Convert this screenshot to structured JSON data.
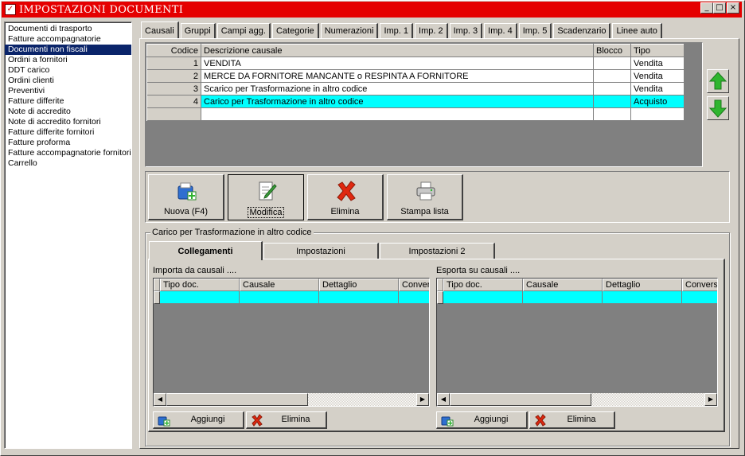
{
  "window": {
    "title": "IMPOSTAZIONI DOCUMENTI",
    "controls": [
      "_",
      "□",
      "×"
    ]
  },
  "sidebar": {
    "items": [
      {
        "label": "Documenti di trasporto"
      },
      {
        "label": "Fatture accompagnatorie"
      },
      {
        "label": "Documenti non fiscali",
        "selected": true
      },
      {
        "label": "Ordini a fornitori"
      },
      {
        "label": "DDT carico"
      },
      {
        "label": "Ordini clienti"
      },
      {
        "label": "Preventivi"
      },
      {
        "label": "Fatture differite"
      },
      {
        "label": "Note di accredito"
      },
      {
        "label": "Note di accredito fornitori"
      },
      {
        "label": "Fatture differite fornitori"
      },
      {
        "label": "Fatture proforma"
      },
      {
        "label": "Fatture accompagnatorie fornitori"
      },
      {
        "label": "Carrello"
      }
    ]
  },
  "tabs": [
    {
      "label": "Causali",
      "active": true
    },
    {
      "label": "Gruppi"
    },
    {
      "label": "Campi agg."
    },
    {
      "label": "Categorie"
    },
    {
      "label": "Numerazioni"
    },
    {
      "label": "Imp. 1"
    },
    {
      "label": "Imp. 2"
    },
    {
      "label": "Imp. 3"
    },
    {
      "label": "Imp. 4"
    },
    {
      "label": "Imp. 5"
    },
    {
      "label": "Scadenzario"
    },
    {
      "label": "Linee auto"
    }
  ],
  "grid": {
    "columns": [
      "Codice",
      "Descrizione causale",
      "Blocco",
      "Tipo"
    ],
    "rows": [
      {
        "codice": "1",
        "descrizione": "VENDITA",
        "blocco": "",
        "tipo": "Vendita"
      },
      {
        "codice": "2",
        "descrizione": "MERCE DA FORNITORE MANCANTE o RESPINTA A FORNITORE",
        "blocco": "",
        "tipo": "Vendita"
      },
      {
        "codice": "3",
        "descrizione": "Scarico per Trasformazione in altro codice",
        "blocco": "",
        "tipo": "Vendita"
      },
      {
        "codice": "4",
        "descrizione": "Carico per Trasformazione in altro codice",
        "blocco": "",
        "tipo": "Acquisto",
        "selected": true
      },
      {
        "codice": "",
        "descrizione": "",
        "blocco": "",
        "tipo": ""
      }
    ]
  },
  "toolbar": {
    "new_label": "Nuova (F4)",
    "edit_label": "Modifica",
    "delete_label": "Elimina",
    "print_label": "Stampa lista"
  },
  "detail": {
    "group_title": "Carico per Trasformazione in altro codice",
    "subtabs": [
      {
        "label": "Collegamenti",
        "active": true
      },
      {
        "label": "Impostazioni"
      },
      {
        "label": "Impostazioni 2"
      }
    ],
    "import": {
      "label": "Importa da causali ....",
      "columns": [
        "Tipo doc.",
        "Causale",
        "Dettaglio",
        "Conver"
      ],
      "add_label": "Aggiungi",
      "delete_label": "Elimina"
    },
    "export": {
      "label": "Esporta su causali ....",
      "columns": [
        "Tipo doc.",
        "Causale",
        "Dettaglio",
        "Conversi"
      ],
      "add_label": "Aggiungi",
      "delete_label": "Elimina"
    }
  },
  "colors": {
    "titlebar": "#e50000",
    "selection": "#0a246a",
    "row_highlight": "#00ffff",
    "arrow_green": "#2fb52f",
    "delete_red": "#e02810"
  }
}
